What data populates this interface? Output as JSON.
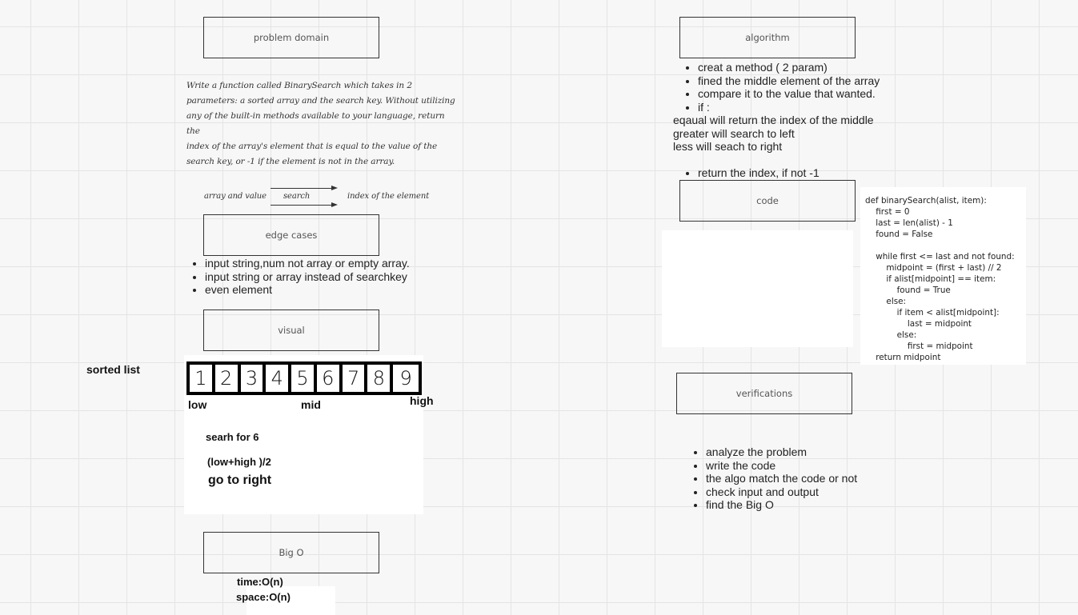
{
  "frames": {
    "problem_domain": "problem domain",
    "edge_cases": "edge cases",
    "visual": "visual",
    "big_o": "Big O",
    "algorithm": "algorithm",
    "code": "code",
    "verifications": "verifications"
  },
  "problem_text": [
    "Write a function called BinarySearch which takes in 2",
    "parameters: a sorted array and the search key. Without utilizing",
    "any of the built-in methods available to your language, return the",
    "index of the array's element that is equal to the value of the",
    "search key, or -1 if the element is not in the array."
  ],
  "flow": {
    "input": "array and value",
    "process": "search",
    "output": "index of the element"
  },
  "edge_list": [
    "input string,num not array or empty array.",
    "input string or array instead of searchkey",
    "even element"
  ],
  "sorted_list": {
    "label": "sorted list",
    "cells": [
      "1",
      "2",
      "3",
      "4",
      "5",
      "6",
      "7",
      "8",
      "9"
    ],
    "low": "low",
    "mid": "mid",
    "high": "high",
    "note1": "searh for 6",
    "note2": "(low+high )/2",
    "note3": "go to right"
  },
  "complexity": {
    "time": "time:O(n)",
    "space": "space:O(n)"
  },
  "algorithm_list_top": [
    "creat a method ( 2 param)",
    "fined the middle element of the array",
    "compare it to the value that wanted.",
    "if :"
  ],
  "algorithm_plain": [
    "eqaual  will return the index of the middle",
    "greater will search to left",
    "less will seach to right"
  ],
  "algorithm_list_bottom": [
    "return the index, if not -1"
  ],
  "code_text": "def binarySearch(alist, item):\n    first = 0\n    last = len(alist) - 1\n    found = False\n\n    while first <= last and not found:\n        midpoint = (first + last) // 2\n        if alist[midpoint] == item:\n            found = True\n        else:\n            if item < alist[midpoint]:\n                last = midpoint\n            else:\n                first = midpoint\n    return midpoint",
  "verification_list": [
    "analyze the problem",
    "write the code",
    "the algo match the code or not",
    "check input and output",
    "find the Big O"
  ]
}
